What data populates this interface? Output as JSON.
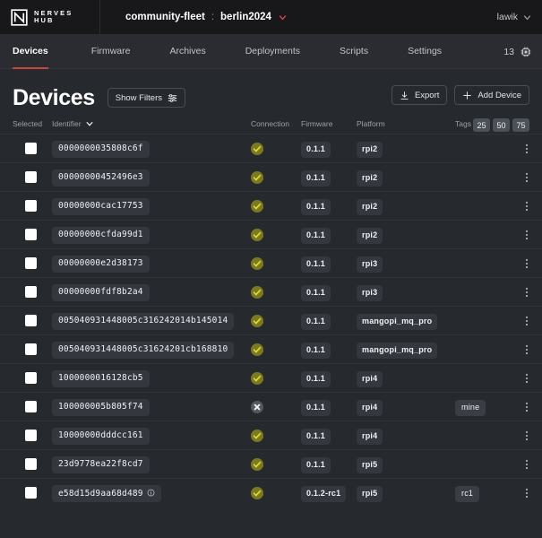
{
  "brand": {
    "line1": "NERVES",
    "line2": "HUB",
    "logo_icon": "nerves-n-logo"
  },
  "header": {
    "org": "community-fleet",
    "separator": ":",
    "product": "berlin2024",
    "product_chevron_icon": "chevron-down-icon",
    "accent_red": "#c0483f",
    "user": "lawik",
    "user_chevron_icon": "chevron-down-icon"
  },
  "nav": {
    "items": [
      {
        "label": "Devices",
        "active": true
      },
      {
        "label": "Firmware",
        "active": false
      },
      {
        "label": "Archives",
        "active": false
      },
      {
        "label": "Deployments",
        "active": false
      },
      {
        "label": "Scripts",
        "active": false
      },
      {
        "label": "Settings",
        "active": false
      }
    ],
    "device_count": "13",
    "count_icon": "chip-icon"
  },
  "page": {
    "title": "Devices",
    "show_filters_label": "Show Filters",
    "show_filters_icon": "sliders-icon",
    "export_label": "Export",
    "export_icon": "download-icon",
    "add_device_label": "Add Device",
    "add_device_icon": "plus-icon"
  },
  "page_sizes": {
    "options": [
      "25",
      "50",
      "75"
    ],
    "selected": "50"
  },
  "table": {
    "columns": [
      {
        "key": "selected",
        "label": "Selected"
      },
      {
        "key": "identifier",
        "label": "Identifier",
        "sort_icon": "chevron-down-icon"
      },
      {
        "key": "connection",
        "label": "Connection"
      },
      {
        "key": "firmware",
        "label": "Firmware"
      },
      {
        "key": "platform",
        "label": "Platform"
      },
      {
        "key": "tags",
        "label": "Tags"
      },
      {
        "key": "menu",
        "label": ""
      }
    ],
    "row_menu_icon": "kebab-menu-icon",
    "status_connected_icon": "check-circle-icon",
    "status_disconnected_icon": "x-circle-icon",
    "status_connected_color": "#7d7a1c",
    "status_disconnected_color": "#55585e",
    "rows": [
      {
        "selected": false,
        "identifier": "0000000035808c6f",
        "info": false,
        "connection": "connected",
        "firmware": "0.1.1",
        "platform": "rpi2",
        "tags": []
      },
      {
        "selected": false,
        "identifier": "00000000452496e3",
        "info": false,
        "connection": "connected",
        "firmware": "0.1.1",
        "platform": "rpi2",
        "tags": []
      },
      {
        "selected": false,
        "identifier": "00000000cac17753",
        "info": false,
        "connection": "connected",
        "firmware": "0.1.1",
        "platform": "rpi2",
        "tags": []
      },
      {
        "selected": false,
        "identifier": "00000000cfda99d1",
        "info": false,
        "connection": "connected",
        "firmware": "0.1.1",
        "platform": "rpi2",
        "tags": []
      },
      {
        "selected": false,
        "identifier": "00000000e2d38173",
        "info": false,
        "connection": "connected",
        "firmware": "0.1.1",
        "platform": "rpi3",
        "tags": []
      },
      {
        "selected": false,
        "identifier": "00000000fdf8b2a4",
        "info": false,
        "connection": "connected",
        "firmware": "0.1.1",
        "platform": "rpi3",
        "tags": []
      },
      {
        "selected": false,
        "identifier": "005040931448005c316242014b145014",
        "info": false,
        "connection": "connected",
        "firmware": "0.1.1",
        "platform": "mangopi_mq_pro",
        "tags": []
      },
      {
        "selected": false,
        "identifier": "005040931448005c31624201cb168810",
        "info": false,
        "connection": "connected",
        "firmware": "0.1.1",
        "platform": "mangopi_mq_pro",
        "tags": []
      },
      {
        "selected": false,
        "identifier": "1000000016128cb5",
        "info": false,
        "connection": "connected",
        "firmware": "0.1.1",
        "platform": "rpi4",
        "tags": []
      },
      {
        "selected": false,
        "identifier": "100000005b805f74",
        "info": false,
        "connection": "disconnected",
        "firmware": "0.1.1",
        "platform": "rpi4",
        "tags": [
          "mine"
        ]
      },
      {
        "selected": false,
        "identifier": "10000000dddcc161",
        "info": false,
        "connection": "connected",
        "firmware": "0.1.1",
        "platform": "rpi4",
        "tags": []
      },
      {
        "selected": false,
        "identifier": "23d9778ea22f8cd7",
        "info": false,
        "connection": "connected",
        "firmware": "0.1.1",
        "platform": "rpi5",
        "tags": []
      },
      {
        "selected": false,
        "identifier": "e58d15d9aa68d489",
        "info": true,
        "info_icon": "info-circle-icon",
        "connection": "connected",
        "firmware": "0.1.2-rc1",
        "platform": "rpi5",
        "tags": [
          "rc1"
        ]
      }
    ]
  }
}
